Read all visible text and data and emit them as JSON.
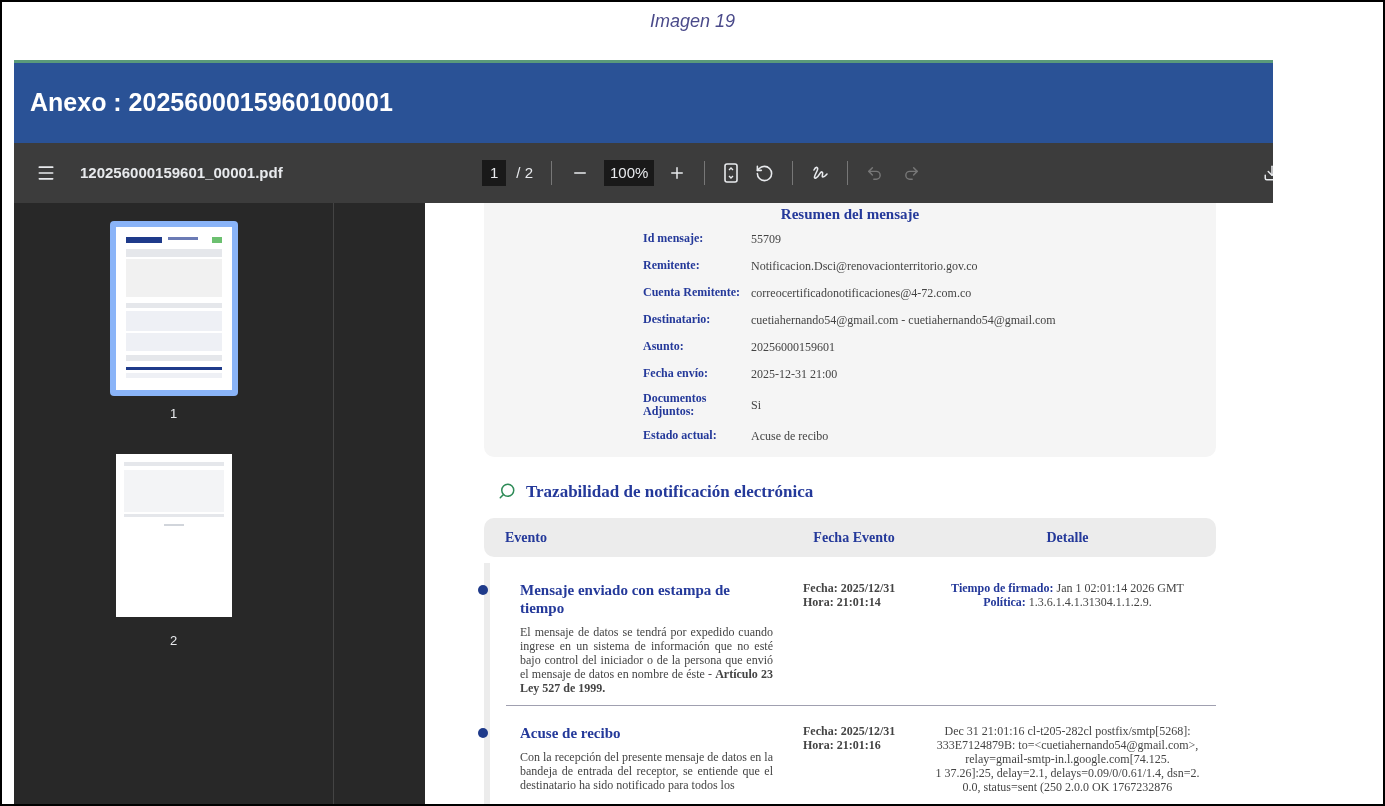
{
  "caption": "Imagen 19",
  "header": {
    "title": "Anexo : 2025600015960100001"
  },
  "toolbar": {
    "file_name": "120256000159601_00001.pdf",
    "page": "1",
    "page_count": "/ 2",
    "zoom": "100%",
    "undo_disabled": true,
    "redo_disabled": true
  },
  "thumbnails": [
    {
      "label": "1",
      "selected": true
    },
    {
      "label": "2",
      "selected": false
    }
  ],
  "summary": {
    "title": "Resumen del mensaje",
    "fields": [
      {
        "label": "Id mensaje:",
        "value": "55709"
      },
      {
        "label": "Remitente:",
        "value": "Notificacion.Dsci@renovacionterritorio.gov.co"
      },
      {
        "label": "Cuenta Remitente:",
        "value": "correocertificadonotificaciones@4-72.com.co"
      },
      {
        "label": "Destinatario:",
        "value": "cuetiahernando54@gmail.com - cuetiahernando54@gmail.com"
      },
      {
        "label": "Asunto:",
        "value": "20256000159601"
      },
      {
        "label": "Fecha envío:",
        "value": "2025-12-31 21:00"
      },
      {
        "label": "Documentos Adjuntos:",
        "value": "Si"
      },
      {
        "label": "Estado actual:",
        "value": "Acuse de recibo"
      }
    ]
  },
  "trace": {
    "title": "Trazabilidad de notificación electrónica",
    "columns": [
      "Evento",
      "Fecha Evento",
      "Detalle"
    ],
    "events": [
      {
        "title": "Mensaje enviado con estampa de tiempo",
        "description": "El mensaje de datos se tendrá por expedido cuando ingrese en un sistema de información que no esté bajo control del iniciador o de la persona que envió el mensaje de datos en nombre de éste - **Artículo 23 Ley 527 de 1999.**",
        "date": "Fecha: 2025/12/31",
        "time": "Hora: 21:01:14",
        "detail_lines": [
          "**Tiempo de firmado:** Jan 1 02:01:14 2026 GMT",
          "**Política:** 1.3.6.1.4.1.31304.1.1.2.9."
        ]
      },
      {
        "title": "Acuse de recibo",
        "description": "Con la recepción del presente mensaje de datos en la bandeja de entrada del receptor, se entiende que el destinatario ha sido notificado para todos los",
        "date": "Fecha: 2025/12/31",
        "time": "Hora: 21:01:16",
        "detail_lines": [
          "Dec 31 21:01:16 cl-t205-282cl postfix/smtp[5268]:",
          "333E7124879B: to=<cuetiahernando54@gmail.com>,",
          "relay=gmail-smtp-in.l.google.com[74.125.",
          "1 37.26]:25, delay=2.1, delays=0.09/0/0.61/1.4, dsn=2.",
          "0.0, status=sent (250 2.0.0 OK 1767232876"
        ]
      }
    ]
  }
}
